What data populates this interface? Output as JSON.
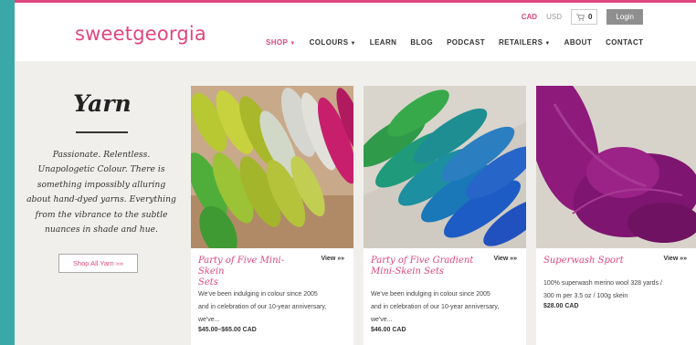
{
  "brand": {
    "logo": "sweetgeorgia",
    "accent": "#e0467f"
  },
  "utility": {
    "cad": "CAD",
    "usd": "USD",
    "cart_count": "0",
    "login": "Login"
  },
  "nav": [
    {
      "label": "SHOP",
      "dropdown": true,
      "active": true
    },
    {
      "label": "COLOURS",
      "dropdown": true,
      "active": false
    },
    {
      "label": "LEARN",
      "dropdown": false,
      "active": false
    },
    {
      "label": "BLOG",
      "dropdown": false,
      "active": false
    },
    {
      "label": "PODCAST",
      "dropdown": false,
      "active": false
    },
    {
      "label": "RETAILERS",
      "dropdown": true,
      "active": false
    },
    {
      "label": "ABOUT",
      "dropdown": false,
      "active": false
    },
    {
      "label": "CONTACT",
      "dropdown": false,
      "active": false
    }
  ],
  "intro": {
    "heading": "Yarn",
    "lines": [
      "Passionate. Relentless.",
      "Unapologetic Colour. There is",
      "something impossibly alluring",
      "about hand-dyed yarns. Everything",
      "from the vibrance to the subtle",
      "nuances in shade and hue."
    ],
    "button": "Shop All Yarn »»"
  },
  "products": [
    {
      "title_lines": [
        "Party of Five Mini-Skein",
        "Sets"
      ],
      "view": "View »»",
      "desc_lines": [
        "We've been indulging in colour since 2005",
        "and in celebration of our 10-year anniversary,",
        "we've..."
      ],
      "price": "$45.00–$65.00 CAD"
    },
    {
      "title_lines": [
        "Party of Five Gradient",
        "Mini-Skein Sets"
      ],
      "view": "View »»",
      "desc_lines": [
        "We've been indulging in colour since 2005",
        "and in celebration of our 10-year anniversary,",
        "we've..."
      ],
      "price": "$46.00 CAD"
    },
    {
      "title_lines": [
        "Superwash Sport"
      ],
      "view": "View »»",
      "desc_lines": [
        "100% superwash merino wool 328 yards /",
        "300 m per 3.5 oz / 100g skein"
      ],
      "price": "$28.00 CAD"
    }
  ]
}
